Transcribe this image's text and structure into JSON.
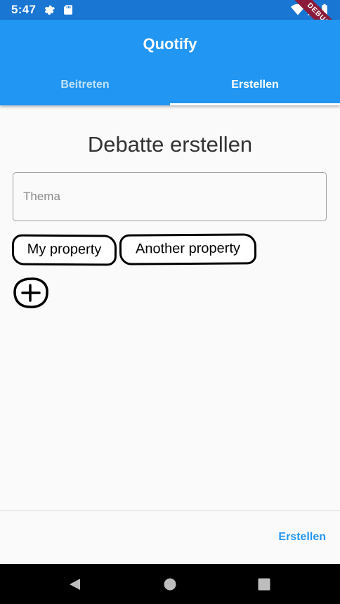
{
  "status_bar": {
    "time": "5:47",
    "debug_label": "DEBUG"
  },
  "app_bar": {
    "title": "Quotify",
    "tabs": [
      {
        "label": "Beitreten",
        "active": false
      },
      {
        "label": "Erstellen",
        "active": true
      }
    ],
    "color": "#2196f3"
  },
  "form": {
    "title": "Debatte erstellen",
    "topic_placeholder": "Thema",
    "topic_value": "",
    "properties": [
      "My property",
      "Another property"
    ]
  },
  "actions": {
    "create_label": "Erstellen"
  },
  "icons": {
    "settings": "gear-icon",
    "sd_card": "sd-card-icon",
    "wifi": "wifi-icon",
    "signal": "signal-icon",
    "battery": "battery-icon",
    "add": "plus-circle-icon",
    "back": "back-triangle-icon",
    "home": "home-circle-icon",
    "recents": "recents-square-icon"
  }
}
